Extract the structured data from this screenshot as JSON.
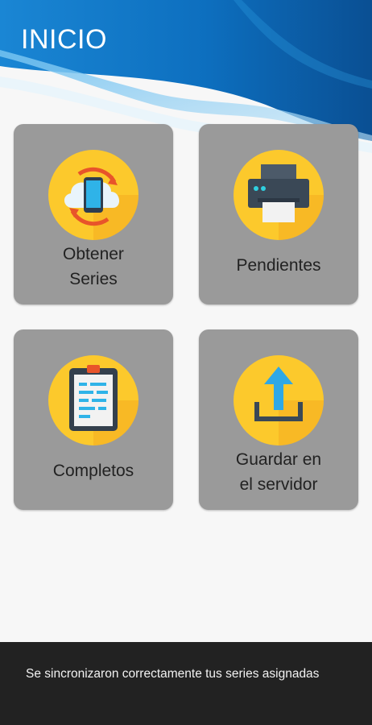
{
  "header": {
    "title": "INICIO"
  },
  "tiles": [
    {
      "label_line1": "Obtener",
      "label_line2": "Series",
      "icon": "cloud-sync-icon"
    },
    {
      "label_line1": "Pendientes",
      "label_line2": "",
      "icon": "printer-icon"
    },
    {
      "label_line1": "Completos",
      "label_line2": "",
      "icon": "clipboard-icon"
    },
    {
      "label_line1": "Guardar en",
      "label_line2": "el servidor",
      "icon": "upload-icon"
    }
  ],
  "snackbar": {
    "message": "Se sincronizaron correctamente tus series asignadas"
  },
  "colors": {
    "header_blue": "#0a6fc2",
    "tile_bg": "#9a9a9a",
    "icon_circle": "#fcc92c",
    "snackbar_bg": "#222222"
  }
}
